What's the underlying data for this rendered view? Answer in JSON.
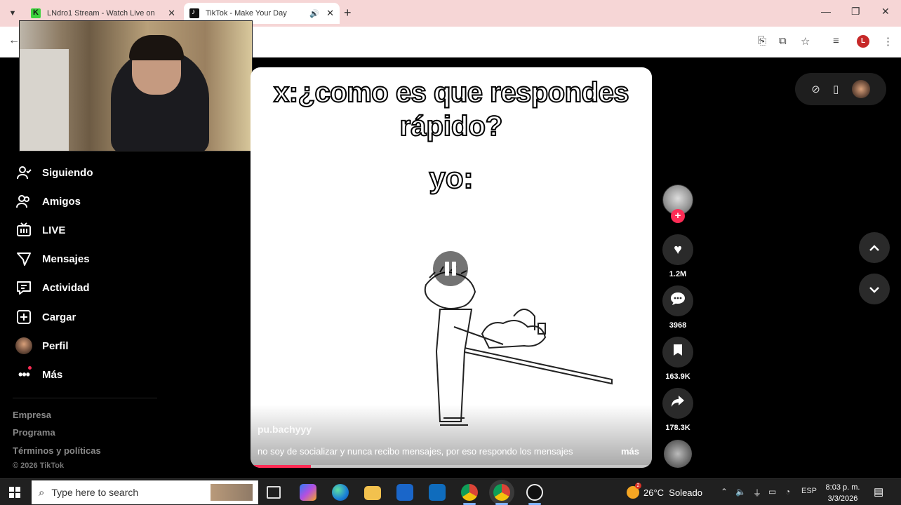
{
  "browser": {
    "tabs": [
      {
        "title": "LNdro1 Stream - Watch Live on",
        "favicon": "kick-icon"
      },
      {
        "title": "TikTok - Make Your Day",
        "favicon": "tiktok-icon",
        "audio": true
      }
    ],
    "tab_close_glyph": "✕",
    "new_tab_glyph": "+",
    "profile_initial": "L"
  },
  "sidebar": {
    "items": [
      {
        "label": "Siguiendo",
        "icon": "following-icon"
      },
      {
        "label": "Amigos",
        "icon": "friends-icon"
      },
      {
        "label": "LIVE",
        "icon": "live-icon"
      },
      {
        "label": "Mensajes",
        "icon": "messages-icon"
      },
      {
        "label": "Actividad",
        "icon": "activity-icon"
      },
      {
        "label": "Cargar",
        "icon": "upload-icon"
      },
      {
        "label": "Perfil",
        "icon": "avatar"
      },
      {
        "label": "Más",
        "icon": "more-icon"
      }
    ],
    "footer": [
      "Empresa",
      "Programa",
      "Términos y políticas"
    ],
    "copyright": "© 2026 TikTok"
  },
  "video": {
    "caption_line1": "x:¿como es que respondes",
    "caption_line2": "rápido?",
    "caption_line3": "yo:",
    "author": "pu.bachyyy",
    "description": "no soy de socializar y nunca recibo mensajes, por eso respondo los mensajes",
    "more_label": "más",
    "progress": 0.15
  },
  "actions": {
    "likes": "1.2M",
    "comments": "3968",
    "saves": "163.9K",
    "shares": "178.3K"
  },
  "taskbar": {
    "search_placeholder": "Type here to search",
    "weather_temp": "26°C",
    "weather_text": "Soleado",
    "weather_badge": "2",
    "language": "ESP",
    "time": "8:03 p. m.",
    "date": "3/3/2026"
  },
  "colors": {
    "accent": "#fe2c55",
    "tabbar": "#f6d6d6",
    "taskbar": "#202020"
  }
}
